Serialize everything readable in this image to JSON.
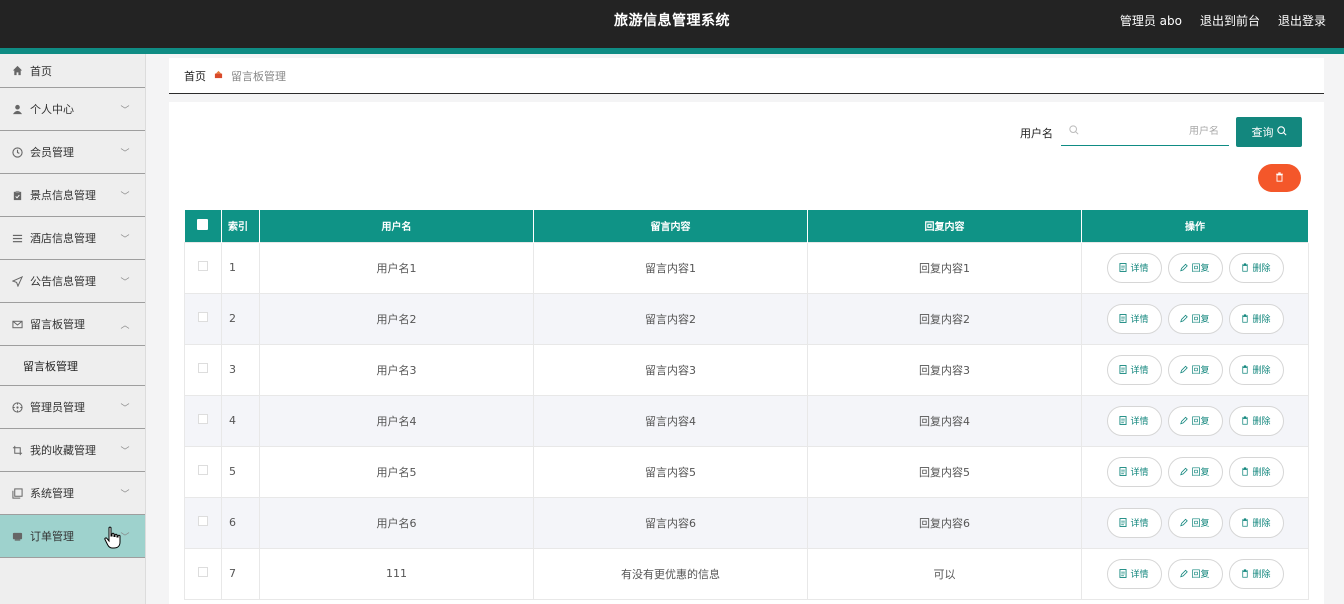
{
  "header": {
    "title": "旅游信息管理系统",
    "admin_label": "管理员 abo",
    "back_label": "退出到前台",
    "logout_label": "退出登录"
  },
  "sidebar": {
    "items": [
      {
        "label": "首页",
        "icon": "home-icon",
        "has_chevron": false
      },
      {
        "label": "个人中心",
        "icon": "user-icon",
        "has_chevron": true
      },
      {
        "label": "会员管理",
        "icon": "clock-icon",
        "has_chevron": true
      },
      {
        "label": "景点信息管理",
        "icon": "clipboard-icon",
        "has_chevron": true
      },
      {
        "label": "酒店信息管理",
        "icon": "list-icon",
        "has_chevron": true
      },
      {
        "label": "公告信息管理",
        "icon": "send-icon",
        "has_chevron": true
      },
      {
        "label": "留言板管理",
        "icon": "mail-icon",
        "has_chevron": true,
        "expanded": true
      },
      {
        "label": "管理员管理",
        "icon": "compass-icon",
        "has_chevron": true
      },
      {
        "label": "我的收藏管理",
        "icon": "crop-icon",
        "has_chevron": true
      },
      {
        "label": "系统管理",
        "icon": "copy-icon",
        "has_chevron": true
      },
      {
        "label": "订单管理",
        "icon": "cart-icon",
        "has_chevron": true,
        "hovered": true
      }
    ],
    "submenu_label": "留言板管理"
  },
  "breadcrumb": {
    "home": "首页",
    "current": "留言板管理"
  },
  "search": {
    "label": "用户名",
    "placeholder": "用户名",
    "value": "",
    "button_label": "查询"
  },
  "table": {
    "headers": [
      "",
      "索引",
      "用户名",
      "留言内容",
      "回复内容",
      "操作"
    ],
    "action_labels": {
      "detail": "详情",
      "reply": "回复",
      "delete": "删除"
    },
    "rows": [
      {
        "index": "1",
        "username": "用户名1",
        "message": "留言内容1",
        "reply": "回复内容1"
      },
      {
        "index": "2",
        "username": "用户名2",
        "message": "留言内容2",
        "reply": "回复内容2"
      },
      {
        "index": "3",
        "username": "用户名3",
        "message": "留言内容3",
        "reply": "回复内容3"
      },
      {
        "index": "4",
        "username": "用户名4",
        "message": "留言内容4",
        "reply": "回复内容4"
      },
      {
        "index": "5",
        "username": "用户名5",
        "message": "留言内容5",
        "reply": "回复内容5"
      },
      {
        "index": "6",
        "username": "用户名6",
        "message": "留言内容6",
        "reply": "回复内容6"
      },
      {
        "index": "7",
        "username": "111",
        "message": "有没有更优惠的信息",
        "reply": "可以"
      }
    ]
  },
  "colors": {
    "header_bg": "#232323",
    "accent": "#0f9386",
    "danger": "#f4572a",
    "sidebar_hover": "#9ed2cd"
  }
}
